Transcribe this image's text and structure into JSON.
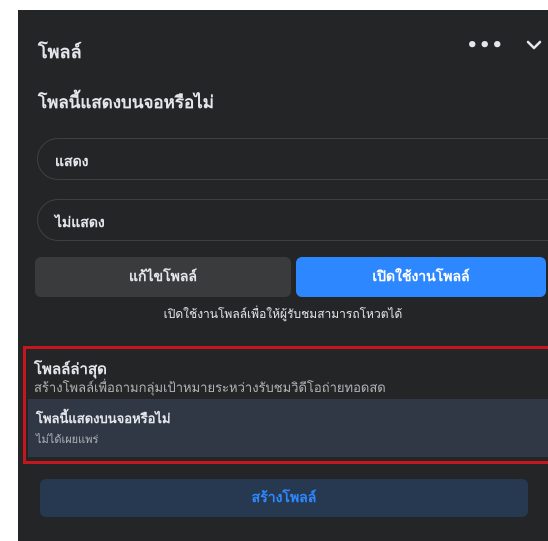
{
  "header": {
    "title": "โพลล์",
    "more_icon": "more-horizontal-icon",
    "collapse_icon": "chevron-down-icon"
  },
  "question": "โพลนี้แสดงบนจอหรือไม่",
  "options": [
    {
      "label": "แสดง"
    },
    {
      "label": "ไม่แสดง"
    }
  ],
  "buttons": {
    "edit": "แก้ไขโพลล์",
    "enable": "เปิดใช้งานโพลล์"
  },
  "hint": "เปิดใช้งานโพลล์เพื่อให้ผู้รับชมสามารถโหวตได้",
  "recent": {
    "title": "โพลล์ล่าสุด",
    "description": "สร้างโพลล์เพื่อถามกลุ่มเป้าหมายระหว่างรับชมวิดีโอถ่ายทอดสด",
    "item": {
      "title": "โพลนี้แสดงบนจอหรือไม่",
      "status": "ไม่ได้เผยแพร่"
    }
  },
  "create_button": "สร้างโพลล์",
  "colors": {
    "panel": "#242526",
    "accent": "#2d88ff",
    "highlight": "#c4161c"
  }
}
